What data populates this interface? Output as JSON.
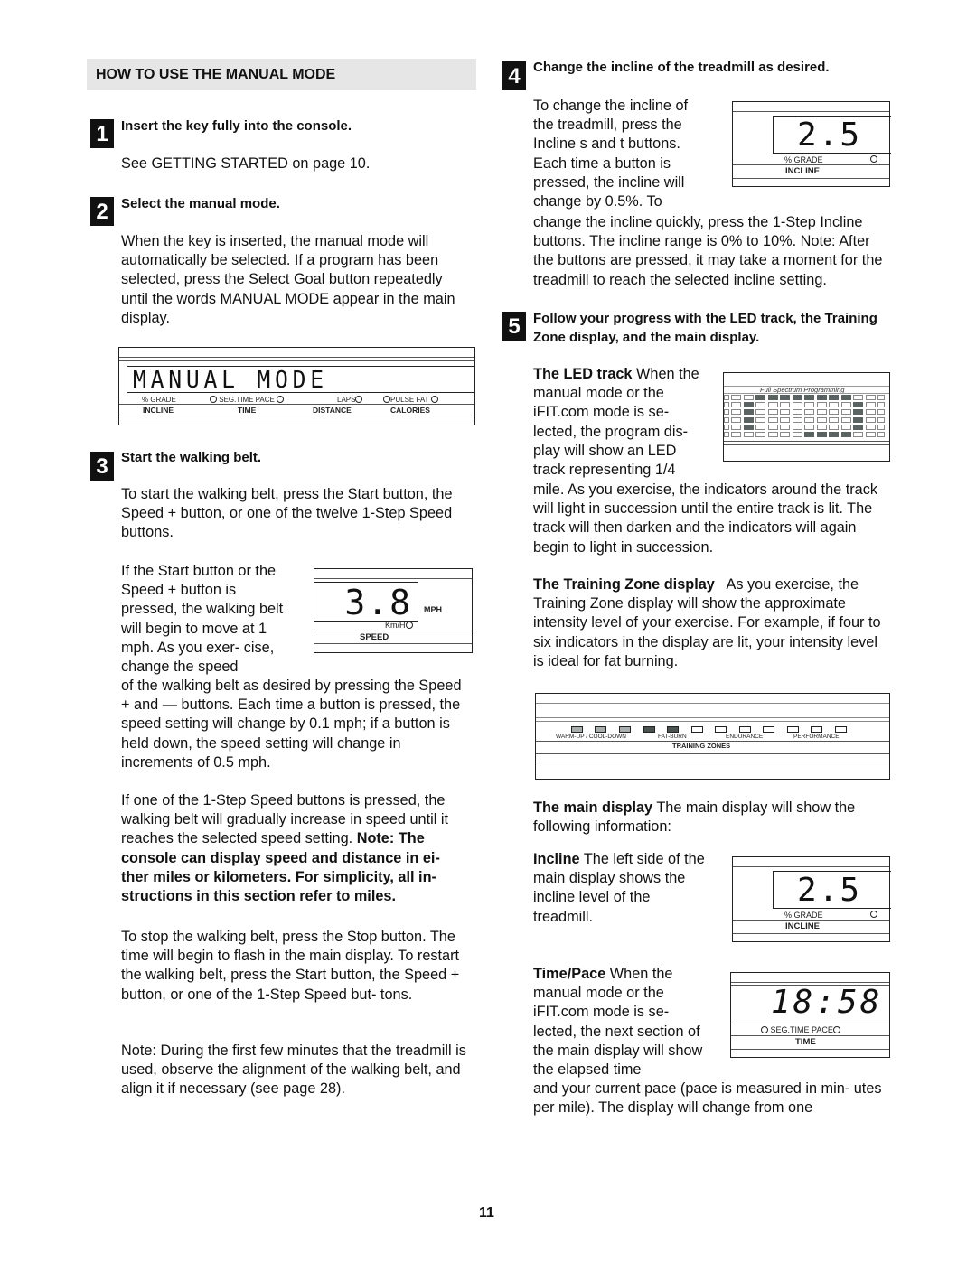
{
  "section_title": "HOW TO USE THE MANUAL MODE",
  "steps": [
    {
      "number": "1",
      "heading": "Insert the key fully into the console.",
      "paragraphs": [
        "See GETTING STARTED on page 10."
      ]
    },
    {
      "number": "2",
      "heading": "Select the manual mode.",
      "paragraphs": [
        "When the key is inserted, the manual mode will automatically be selected. If a program has been selected, press the Select Goal button repeatedly until the words  MANUAL MODE  appear in the main display."
      ]
    },
    {
      "number": "3",
      "heading": "Start the walking belt.",
      "paragraphs": [
        "To start the walking belt, press the Start button, the Speed + button, or one of the twelve 1-Step Speed buttons.",
        "If the Start button or the Speed + button is pressed, the walking belt will begin to move at 1 mph. As you exer- cise, change the speed",
        "of the walking belt as desired by pressing the Speed + and — buttons. Each time a button is pressed, the speed setting will change by 0.1 mph; if a button is held down, the speed setting will change in increments of 0.5 mph.",
        "If one of the 1-Step Speed buttons is pressed, the walking belt will gradually increase in speed until it reaches the selected speed setting.",
        "To stop the walking belt, press the Stop button. The time will begin to flash in the main display. To restart the walking belt, press the Start button, the Speed + button, or one of the 1-Step Speed but- tons.",
        "Note: During the first few minutes that the treadmill is used, observe the alignment of the walking belt, and align it if necessary (see page 28)."
      ],
      "bold_note": "Note: The console can display speed and distance in ei- ther miles or kilometers. For simplicity, all in- structions in this section refer to miles."
    },
    {
      "number": "4",
      "heading": "Change the incline of the treadmill as desired.",
      "paragraphs": [
        "To change the incline of the treadmill, press the Incline s and t buttons. Each time a button is pressed, the incline will change by 0.5%. To",
        "change the incline quickly, press the 1-Step Incline buttons. The incline range is 0% to 10%. Note: After the buttons are pressed, it may take a moment for the treadmill to reach the selected incline setting."
      ]
    },
    {
      "number": "5",
      "heading": "Follow your progress with the LED track, the Training Zone display, and the main display.",
      "subsections": [
        {
          "title": "The LED track",
          "text": "When the manual mode or the iFIT.com mode is se- lected, the program dis- play will show an LED track representing 1/4",
          "continued": "mile. As you exercise, the indicators around the track will light in succession until the entire track is lit. The track will then darken and the indicators will again begin to light in succession."
        },
        {
          "title": "The Training Zone display",
          "text": "As you exercise, the Training Zone display will show the approximate intensity level of your exercise. For example, if four to six indicators in the display are lit, your intensity level is ideal for fat burning."
        },
        {
          "title": "The main display",
          "text": "The main display will show the following information:"
        },
        {
          "title": "Incline",
          "text": "The left side of the main display shows the incline level of the treadmill."
        },
        {
          "title": "Time/Pace",
          "text": "When the manual mode or the iFIT.com mode is se- lected, the next section of the main display will show the elapsed time",
          "continued": "and your current pace (pace is measured in min- utes per mile). The display will change from one"
        }
      ]
    }
  ],
  "displays": {
    "main": {
      "readout": "MANUAL MODE",
      "labels": [
        "% GRADE",
        "SEG.TIME  PACE",
        "LAPS",
        "PULSE  FAT"
      ],
      "sections": [
        "INCLINE",
        "TIME",
        "DISTANCE",
        "CALORIES"
      ]
    },
    "speed": {
      "readout": "3.8",
      "unit": "MPH",
      "alt_unit": "Km/H",
      "label": "SPEED"
    },
    "incline": {
      "readout": "2.5",
      "unit": "% GRADE",
      "label": "INCLINE"
    },
    "led_track": {
      "title": "Full Spectrum Programming",
      "rows": [
        [
          0,
          0,
          1,
          1,
          1,
          1,
          1,
          1,
          1,
          1,
          0,
          0
        ],
        [
          0,
          1,
          0,
          0,
          0,
          0,
          0,
          0,
          0,
          0,
          1,
          0
        ],
        [
          0,
          1,
          0,
          0,
          0,
          0,
          0,
          0,
          0,
          0,
          1,
          0
        ],
        [
          0,
          1,
          0,
          0,
          0,
          0,
          0,
          0,
          0,
          0,
          1,
          0
        ],
        [
          0,
          1,
          0,
          0,
          0,
          0,
          0,
          0,
          0,
          0,
          1,
          0
        ],
        [
          0,
          0,
          0,
          0,
          0,
          0,
          1,
          1,
          1,
          1,
          0,
          0
        ]
      ]
    },
    "training_zones": {
      "label": "TRAINING ZONES",
      "zones": [
        "WARM-UP / COOL-DOWN",
        "FAT-BURN",
        "ENDURANCE",
        "PERFORMANCE"
      ],
      "leds": [
        "light",
        "light",
        "light",
        "dark",
        "dark",
        "off",
        "off",
        "off",
        "off",
        "off",
        "off",
        "off"
      ]
    },
    "time": {
      "readout": "18:58",
      "labels": "SEG.TIME  PACE",
      "label": "TIME"
    }
  },
  "page_number": "11"
}
